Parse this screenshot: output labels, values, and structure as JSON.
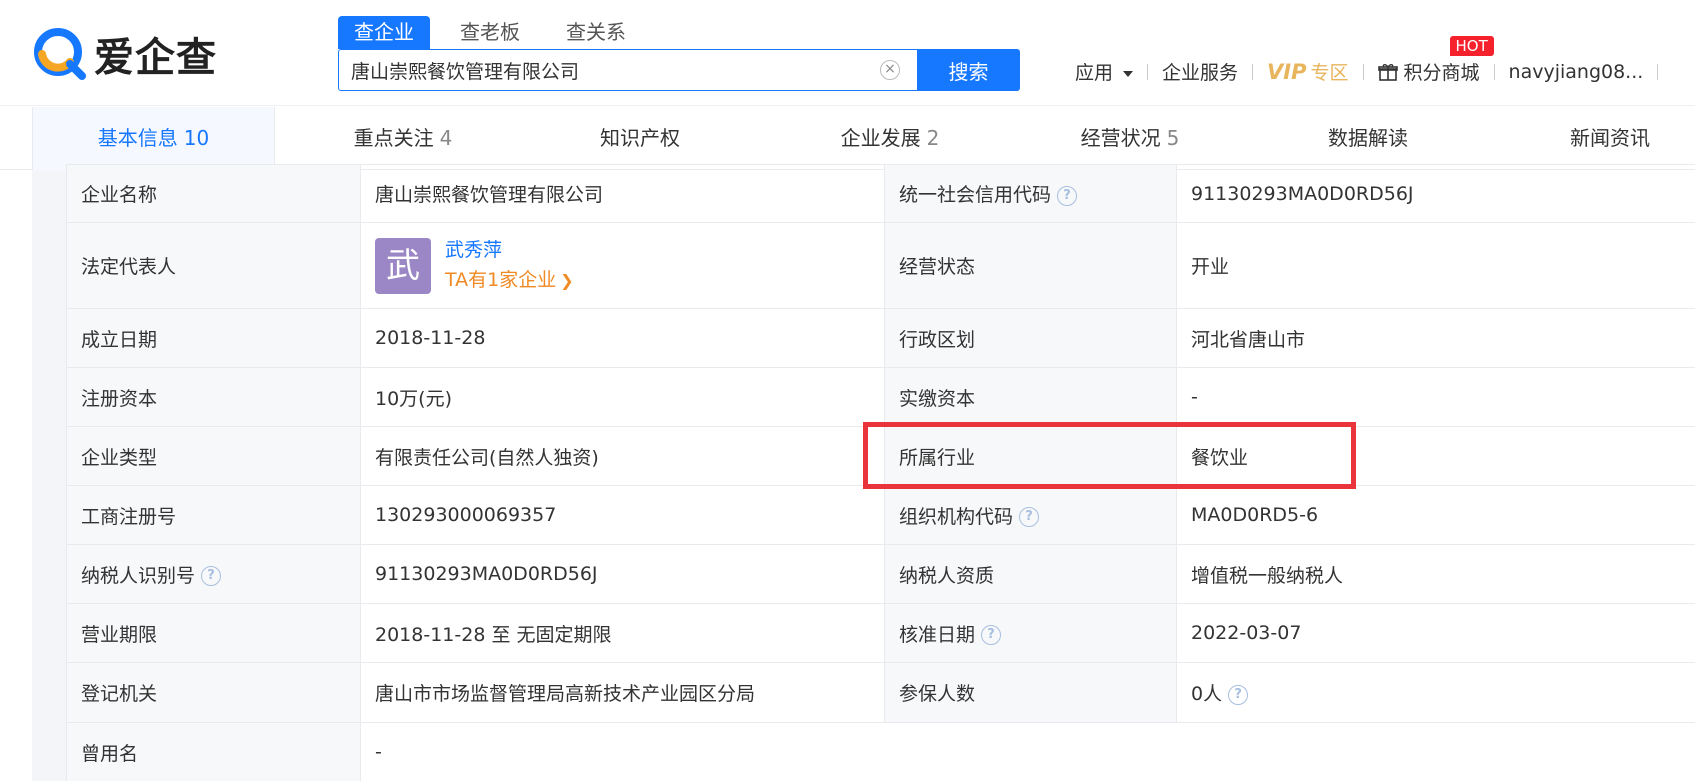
{
  "header": {
    "logo_text": "爱企查",
    "search_tabs": [
      "查企业",
      "查老板",
      "查关系"
    ],
    "search_value": "唐山崇熙餐饮管理有限公司",
    "clear_symbol": "×",
    "search_button": "搜索",
    "nav": {
      "apps": "应用",
      "services": "企业服务",
      "vip": "VIP",
      "vip_zone": "专区",
      "points": "积分商城",
      "hot": "HOT",
      "user": "navyjiang08..."
    }
  },
  "tabs": [
    {
      "label": "基本信息",
      "count": "10"
    },
    {
      "label": "重点关注",
      "count": "4"
    },
    {
      "label": "知识产权",
      "count": ""
    },
    {
      "label": "企业发展",
      "count": "2"
    },
    {
      "label": "经营状况",
      "count": "5"
    },
    {
      "label": "数据解读",
      "count": ""
    },
    {
      "label": "新闻资讯",
      "count": ""
    }
  ],
  "info": {
    "company_name_label": "企业名称",
    "company_name": "唐山崇熙餐饮管理有限公司",
    "credit_code_label": "统一社会信用代码",
    "credit_code": "91130293MA0D0RD56J",
    "legal_rep_label": "法定代表人",
    "legal_rep_avatar": "武",
    "legal_rep_name": "武秀萍",
    "legal_rep_link": "TA有1家企业",
    "status_label": "经营状态",
    "status": "开业",
    "founded_label": "成立日期",
    "founded": "2018-11-28",
    "region_label": "行政区划",
    "region": "河北省唐山市",
    "reg_capital_label": "注册资本",
    "reg_capital": "10万(元)",
    "paid_capital_label": "实缴资本",
    "paid_capital": "-",
    "type_label": "企业类型",
    "type": "有限责任公司(自然人独资)",
    "industry_label": "所属行业",
    "industry": "餐饮业",
    "reg_no_label": "工商注册号",
    "reg_no": "130293000069357",
    "org_code_label": "组织机构代码",
    "org_code": "MA0D0RD5-6",
    "tax_id_label": "纳税人识别号",
    "tax_id": "91130293MA0D0RD56J",
    "tax_qual_label": "纳税人资质",
    "tax_qual": "增值税一般纳税人",
    "term_label": "营业期限",
    "term": "2018-11-28 至 无固定期限",
    "approval_label": "核准日期",
    "approval": "2022-03-07",
    "authority_label": "登记机关",
    "authority": "唐山市市场监督管理局高新技术产业园区分局",
    "insured_label": "参保人数",
    "insured": "0人",
    "former_name_label": "曾用名",
    "former_name": "-"
  },
  "colors": {
    "primary": "#1677ff",
    "highlight_box": "#e8343a",
    "vip": "#e8b45c",
    "link_orange": "#f08a24",
    "avatar_bg": "#9b87c6"
  }
}
